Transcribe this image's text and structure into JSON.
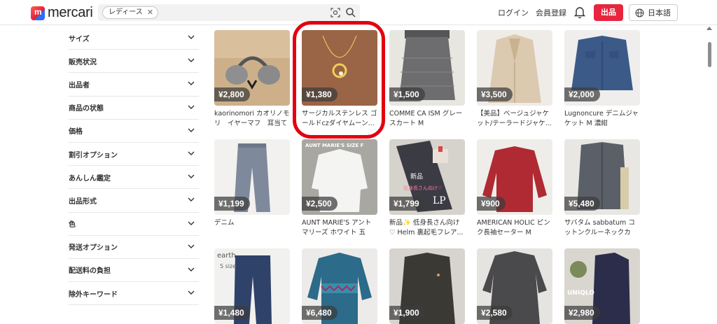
{
  "header": {
    "logo_text": "mercari",
    "search": {
      "chip": "レディース",
      "value": "",
      "placeholder": ""
    },
    "login": "ログイン",
    "signup": "会員登録",
    "sell": "出品",
    "language": "日本語"
  },
  "sidebar": {
    "filters": [
      {
        "label": "サイズ"
      },
      {
        "label": "販売状況"
      },
      {
        "label": "出品者"
      },
      {
        "label": "商品の状態"
      },
      {
        "label": "価格"
      },
      {
        "label": "割引オプション"
      },
      {
        "label": "あんしん鑑定"
      },
      {
        "label": "出品形式"
      },
      {
        "label": "色"
      },
      {
        "label": "発送オプション"
      },
      {
        "label": "配送料の負担"
      },
      {
        "label": "除外キーワード"
      }
    ]
  },
  "items": [
    {
      "price": "¥2,800",
      "title": "kaorinomori カオリノモリ　イヤーマフ　耳当て",
      "bg": "#c8ab86"
    },
    {
      "price": "¥1,380",
      "title": "サージカルステンレス ゴールドczダイヤムーン...",
      "bg": "#9a6446"
    },
    {
      "price": "¥1,500",
      "title": "COMME CA ISM グレースカート M",
      "bg": "#6f6f72"
    },
    {
      "price": "¥3,500",
      "title": "【美品】ベージュジャケット/テーラードジャケ...",
      "bg": "#d9c9ad"
    },
    {
      "price": "¥2,000",
      "title": "Lugnoncure デニムジャケット M 濃紺",
      "bg": "#3d5a86"
    },
    {
      "price": "¥1,199",
      "title": "デニム",
      "bg": "#7d8794"
    },
    {
      "price": "¥2,500",
      "title": "AUNT MARIE'S アントマリーズ ホワイト 五分...",
      "bg": "#d8d8d6"
    },
    {
      "price": "¥1,799",
      "title": "新品✨ 低身長さん向け♡ Helm 裏起毛フレア...",
      "bg": "#3b3b44"
    },
    {
      "price": "¥900",
      "title": "AMERICAN HOLIC ピンク長袖セーター M",
      "bg": "#b22b34"
    },
    {
      "price": "¥5,480",
      "title": "サバタム sabbatum コットンクルーネックカー...",
      "bg": "#5c6169"
    },
    {
      "price": "¥1,480",
      "title": "",
      "bg": "#2f4269"
    },
    {
      "price": "¥6,480",
      "title": "",
      "bg": "#2f6e8c"
    },
    {
      "price": "¥1,900",
      "title": "",
      "bg": "#3d3a33"
    },
    {
      "price": "¥2,580",
      "title": "",
      "bg": "#4a4a4c"
    },
    {
      "price": "¥2,980",
      "title": "",
      "bg": "#2c2d4a"
    }
  ],
  "overlay_texts": {
    "aunt": "AUNT MARIE'S SIZE F",
    "new": "新品",
    "short": "低身長さん向け♡",
    "lp": "LP",
    "earth": "earth",
    "size": "S size",
    "uniqlo": "UNIQLO"
  }
}
